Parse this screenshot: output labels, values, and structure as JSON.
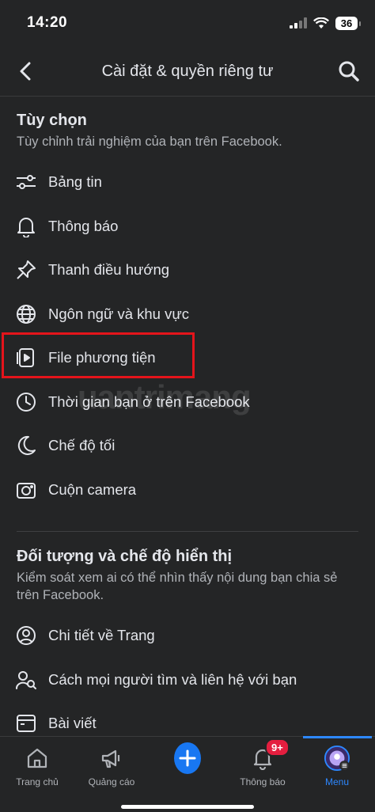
{
  "status": {
    "time": "14:20",
    "battery": "36"
  },
  "header": {
    "title": "Cài đặt & quyền riêng tư"
  },
  "watermark": "uantrimang",
  "preferences": {
    "title": "Tùy chọn",
    "subtitle": "Tùy chỉnh trải nghiệm của bạn trên Facebook.",
    "items": [
      {
        "label": "Bảng tin",
        "icon": "sliders-icon"
      },
      {
        "label": "Thông báo",
        "icon": "bell-icon"
      },
      {
        "label": "Thanh điều hướng",
        "icon": "pin-icon"
      },
      {
        "label": "Ngôn ngữ và khu vực",
        "icon": "globe-icon"
      },
      {
        "label": "File phương tiện",
        "icon": "media-file-icon"
      },
      {
        "label": "Thời gian bạn ở trên Facebook",
        "icon": "clock-icon"
      },
      {
        "label": "Chế độ tối",
        "icon": "moon-icon"
      },
      {
        "label": "Cuộn camera",
        "icon": "camera-icon"
      }
    ]
  },
  "audience": {
    "title": "Đối tượng và chế độ hiển thị",
    "subtitle": "Kiểm soát xem ai có thể nhìn thấy nội dung bạn chia sẻ trên Facebook.",
    "items": [
      {
        "label": "Chi tiết về Trang",
        "icon": "user-circle-icon"
      },
      {
        "label": "Cách mọi người tìm và liên hệ với bạn",
        "icon": "user-search-icon"
      },
      {
        "label": "Bài viết",
        "icon": "post-icon"
      }
    ]
  },
  "nav": {
    "items": [
      {
        "label": "Trang chủ",
        "icon": "home-icon"
      },
      {
        "label": "Quảng cáo",
        "icon": "megaphone-icon"
      },
      {
        "label": "",
        "icon": "plus-icon"
      },
      {
        "label": "Thông báo",
        "icon": "bell-icon",
        "badge": "9+"
      },
      {
        "label": "Menu",
        "icon": "avatar-icon",
        "active": true
      }
    ]
  },
  "colors": {
    "background": "#242526",
    "accent": "#2d88ff",
    "highlight": "#e4141b",
    "badge": "#e41e3f"
  }
}
